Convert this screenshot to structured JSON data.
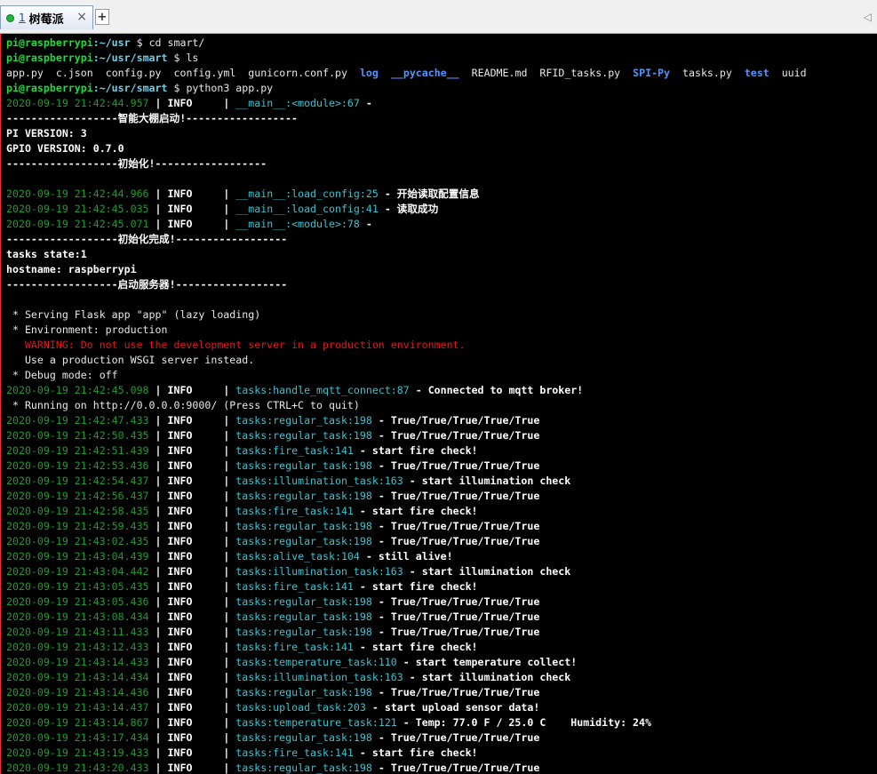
{
  "tab": {
    "index": "1",
    "title": "树莓派",
    "close": "×",
    "add": "+",
    "menu": "◁"
  },
  "colors": {
    "prompt": "#1fdc3c",
    "path": "#6ed0e8",
    "dir": "#4f96ff",
    "timestamp": "#1a9e2c",
    "module": "#36c4d0",
    "warning": "#e01818"
  },
  "prompt": {
    "user": "pi@raspberrypi"
  },
  "lines": [
    {
      "type": "prompt",
      "path": ":~/usr",
      "cmd": " $ cd smart/"
    },
    {
      "type": "prompt",
      "path": ":~/usr/smart",
      "cmd": " $ ls"
    },
    {
      "type": "ls",
      "items": [
        {
          "text": "app.py",
          "dir": false
        },
        {
          "text": "c.json",
          "dir": false
        },
        {
          "text": "config.py",
          "dir": false
        },
        {
          "text": "config.yml",
          "dir": false
        },
        {
          "text": "gunicorn.conf.py",
          "dir": false
        },
        {
          "text": "log",
          "dir": true
        },
        {
          "text": "__pycache__",
          "dir": true
        },
        {
          "text": "README.md",
          "dir": false
        },
        {
          "text": "RFID_tasks.py",
          "dir": false
        },
        {
          "text": "SPI-Py",
          "dir": true
        },
        {
          "text": "tasks.py",
          "dir": false
        },
        {
          "text": "test",
          "dir": true
        },
        {
          "text": "uuid",
          "dir": false
        }
      ]
    },
    {
      "type": "prompt",
      "path": ":~/usr/smart",
      "cmd": " $ python3 app.py"
    },
    {
      "type": "log",
      "ts": "2020-09-19 21:42:44.957",
      "level": "INFO",
      "mod": "__main__:<module>:67",
      "msg": ""
    },
    {
      "type": "bold",
      "text": "------------------智能大棚启动!------------------"
    },
    {
      "type": "bold",
      "text": "PI VERSION: 3"
    },
    {
      "type": "bold",
      "text": "GPIO VERSION: 0.7.0"
    },
    {
      "type": "bold",
      "text": "------------------初始化!------------------"
    },
    {
      "type": "blank"
    },
    {
      "type": "log",
      "ts": "2020-09-19 21:42:44.966",
      "level": "INFO",
      "mod": "__main__:load_config:25",
      "msg": "开始读取配置信息"
    },
    {
      "type": "log",
      "ts": "2020-09-19 21:42:45.035",
      "level": "INFO",
      "mod": "__main__:load_config:41",
      "msg": "读取成功"
    },
    {
      "type": "log",
      "ts": "2020-09-19 21:42:45.071",
      "level": "INFO",
      "mod": "__main__:<module>:78",
      "msg": ""
    },
    {
      "type": "bold",
      "text": "------------------初始化完成!------------------"
    },
    {
      "type": "bold",
      "text": "tasks state:1"
    },
    {
      "type": "bold",
      "text": "hostname: raspberrypi"
    },
    {
      "type": "bold",
      "text": "------------------启动服务器!------------------"
    },
    {
      "type": "blank"
    },
    {
      "type": "plain",
      "text": " * Serving Flask app \"app\" (lazy loading)"
    },
    {
      "type": "plain",
      "text": " * Environment: production"
    },
    {
      "type": "warn",
      "text": "   WARNING: Do not use the development server in a production environment."
    },
    {
      "type": "plain",
      "text": "   Use a production WSGI server instead."
    },
    {
      "type": "plain",
      "text": " * Debug mode: off"
    },
    {
      "type": "log",
      "ts": "2020-09-19 21:42:45.098",
      "level": "INFO",
      "mod": "tasks:handle_mqtt_connect:87",
      "msg": "Connected to mqtt broker!"
    },
    {
      "type": "plain",
      "text": " * Running on http://0.0.0.0:9000/ (Press CTRL+C to quit)"
    },
    {
      "type": "log",
      "ts": "2020-09-19 21:42:47.433",
      "level": "INFO",
      "mod": "tasks:regular_task:198",
      "msg": "True/True/True/True/True"
    },
    {
      "type": "log",
      "ts": "2020-09-19 21:42:50.435",
      "level": "INFO",
      "mod": "tasks:regular_task:198",
      "msg": "True/True/True/True/True"
    },
    {
      "type": "log",
      "ts": "2020-09-19 21:42:51.439",
      "level": "INFO",
      "mod": "tasks:fire_task:141",
      "msg": "start fire check!"
    },
    {
      "type": "log",
      "ts": "2020-09-19 21:42:53.436",
      "level": "INFO",
      "mod": "tasks:regular_task:198",
      "msg": "True/True/True/True/True"
    },
    {
      "type": "log",
      "ts": "2020-09-19 21:42:54.437",
      "level": "INFO",
      "mod": "tasks:illumination_task:163",
      "msg": "start illumination check"
    },
    {
      "type": "log",
      "ts": "2020-09-19 21:42:56.437",
      "level": "INFO",
      "mod": "tasks:regular_task:198",
      "msg": "True/True/True/True/True"
    },
    {
      "type": "log",
      "ts": "2020-09-19 21:42:58.435",
      "level": "INFO",
      "mod": "tasks:fire_task:141",
      "msg": "start fire check!"
    },
    {
      "type": "log",
      "ts": "2020-09-19 21:42:59.435",
      "level": "INFO",
      "mod": "tasks:regular_task:198",
      "msg": "True/True/True/True/True"
    },
    {
      "type": "log",
      "ts": "2020-09-19 21:43:02.435",
      "level": "INFO",
      "mod": "tasks:regular_task:198",
      "msg": "True/True/True/True/True"
    },
    {
      "type": "log",
      "ts": "2020-09-19 21:43:04.439",
      "level": "INFO",
      "mod": "tasks:alive_task:104",
      "msg": "still alive!"
    },
    {
      "type": "log",
      "ts": "2020-09-19 21:43:04.442",
      "level": "INFO",
      "mod": "tasks:illumination_task:163",
      "msg": "start illumination check"
    },
    {
      "type": "log",
      "ts": "2020-09-19 21:43:05.435",
      "level": "INFO",
      "mod": "tasks:fire_task:141",
      "msg": "start fire check!"
    },
    {
      "type": "log",
      "ts": "2020-09-19 21:43:05.436",
      "level": "INFO",
      "mod": "tasks:regular_task:198",
      "msg": "True/True/True/True/True"
    },
    {
      "type": "log",
      "ts": "2020-09-19 21:43:08.434",
      "level": "INFO",
      "mod": "tasks:regular_task:198",
      "msg": "True/True/True/True/True"
    },
    {
      "type": "log",
      "ts": "2020-09-19 21:43:11.433",
      "level": "INFO",
      "mod": "tasks:regular_task:198",
      "msg": "True/True/True/True/True"
    },
    {
      "type": "log",
      "ts": "2020-09-19 21:43:12.433",
      "level": "INFO",
      "mod": "tasks:fire_task:141",
      "msg": "start fire check!"
    },
    {
      "type": "log",
      "ts": "2020-09-19 21:43:14.433",
      "level": "INFO",
      "mod": "tasks:temperature_task:110",
      "msg": "start temperature collect!"
    },
    {
      "type": "log",
      "ts": "2020-09-19 21:43:14.434",
      "level": "INFO",
      "mod": "tasks:illumination_task:163",
      "msg": "start illumination check"
    },
    {
      "type": "log",
      "ts": "2020-09-19 21:43:14.436",
      "level": "INFO",
      "mod": "tasks:regular_task:198",
      "msg": "True/True/True/True/True"
    },
    {
      "type": "log",
      "ts": "2020-09-19 21:43:14.437",
      "level": "INFO",
      "mod": "tasks:upload_task:203",
      "msg": "start upload sensor data!"
    },
    {
      "type": "log",
      "ts": "2020-09-19 21:43:14.867",
      "level": "INFO",
      "mod": "tasks:temperature_task:121",
      "msg": "Temp: 77.0 F / 25.0 C    Humidity: 24%"
    },
    {
      "type": "log",
      "ts": "2020-09-19 21:43:17.434",
      "level": "INFO",
      "mod": "tasks:regular_task:198",
      "msg": "True/True/True/True/True"
    },
    {
      "type": "log",
      "ts": "2020-09-19 21:43:19.433",
      "level": "INFO",
      "mod": "tasks:fire_task:141",
      "msg": "start fire check!"
    },
    {
      "type": "log",
      "ts": "2020-09-19 21:43:20.433",
      "level": "INFO",
      "mod": "tasks:regular_task:198",
      "msg": "True/True/True/True/True"
    }
  ]
}
